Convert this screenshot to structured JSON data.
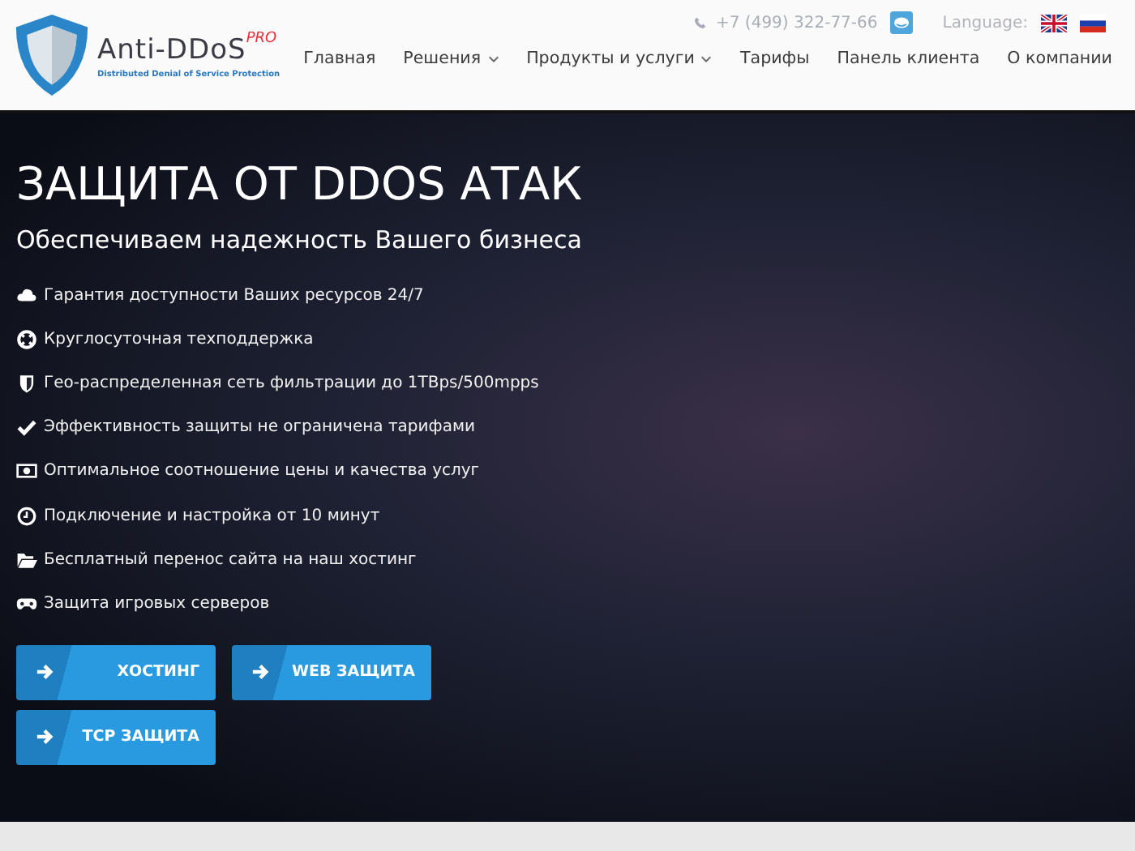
{
  "header": {
    "logo": {
      "name": "Anti-DDoS",
      "badge": "PRO",
      "tagline": "Distributed Denial of Service Protection"
    },
    "phone": "+7 (499) 322-77-66",
    "language_label": "Language:",
    "nav": [
      {
        "label": "Главная",
        "dropdown": false
      },
      {
        "label": "Решения",
        "dropdown": true
      },
      {
        "label": "Продукты и услуги",
        "dropdown": true
      },
      {
        "label": "Тарифы",
        "dropdown": false
      },
      {
        "label": "Панель клиента",
        "dropdown": false
      },
      {
        "label": "О компании",
        "dropdown": false
      }
    ]
  },
  "hero": {
    "title": "ЗАЩИТА ОТ DDOS АТАК",
    "subtitle": "Обеспечиваем надежность Вашего бизнеса",
    "features": [
      {
        "kind": "cloud",
        "text": "Гарантия доступности Ваших ресурсов 24/7"
      },
      {
        "kind": "lifebuoy",
        "text": "Круглосуточная техподдержка"
      },
      {
        "kind": "shield",
        "text": "Гео-распределенная сеть фильтрации до 1TBps/500mpps"
      },
      {
        "kind": "check",
        "text": "Эффективность защиты не ограничена тарифами"
      },
      {
        "kind": "money",
        "text": "Оптимальное соотношение цены и качества услуг"
      },
      {
        "kind": "clock",
        "text": "Подключение и настройка от 10 минут"
      },
      {
        "kind": "folder",
        "text": "Бесплатный перенос сайта на наш хостинг"
      },
      {
        "kind": "gamepad",
        "text": "Защита игровых серверов"
      }
    ],
    "buttons": [
      "ХОСТИНГ",
      "WEB ЗАЩИТА",
      "TCP ЗАЩИТА"
    ]
  }
}
